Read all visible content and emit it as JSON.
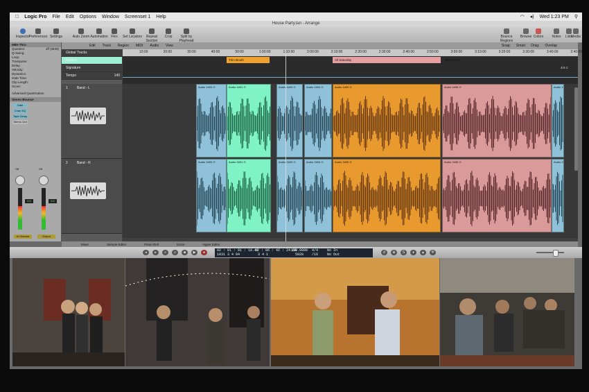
{
  "menubar": {
    "apple": "",
    "app": "Logic Pro",
    "items": [
      "File",
      "Edit",
      "Options",
      "Window",
      "Screenset 1",
      "Help"
    ],
    "clock": "Wed 1:23 PM"
  },
  "window": {
    "title": "House Party.lan - Arrange"
  },
  "toolbar": {
    "left": [
      "Inspector",
      "Preferences",
      "Settings",
      "Auto Zoom",
      "Automation",
      "Flex",
      "Set Locators",
      "Repeat Section",
      "Crop",
      "Split by Playhead"
    ],
    "right": [
      "Bounce Regions",
      "Browse",
      "Colors",
      "Notes",
      "Lists",
      "Media"
    ]
  },
  "inspector": {
    "title": "MIDI Thru",
    "rows": [
      {
        "k": "Quantize:",
        "v": "off (3840)"
      },
      {
        "k": "Q-Swing:",
        "v": ""
      },
      {
        "k": "Loop:",
        "v": ""
      },
      {
        "k": "Transpose:",
        "v": ""
      },
      {
        "k": "Delay:",
        "v": ""
      },
      {
        "k": "Velocity:",
        "v": ""
      },
      {
        "k": "Dynamics:",
        "v": ""
      },
      {
        "k": "Gate Time:",
        "v": ""
      },
      {
        "k": "Clip Length:",
        "v": ""
      },
      {
        "k": "Score:",
        "v": ""
      }
    ],
    "advanced": "Advanced Quantization",
    "sub": "Stereo Bounce",
    "btn1": "Gate",
    "btn2": "Chan EQ",
    "btn3": "Tape Delay",
    "stereo_out": "Stereo Out",
    "ch1_off": "Off",
    "ch2_off": "Off",
    "ch1_val": "0.0",
    "ch2_val": "0.0",
    "ch1_label": "Ac Bassist",
    "ch2_label": "Output"
  },
  "local": {
    "items": [
      "Edit",
      "Track",
      "Region",
      "MIDI",
      "Audio",
      "View"
    ],
    "snap_label": "Snap:",
    "snap": "Smart",
    "drag_label": "Drag:",
    "drag": "Overlap"
  },
  "tracks": {
    "global": "Global Tracks",
    "marker": "Marker",
    "signature": "Signature",
    "tempo": "Tempo",
    "tempo_vals": [
      "140",
      "100"
    ],
    "t1": "Band - L",
    "t2": "Band - R",
    "num1": "1",
    "num2": "2"
  },
  "ruler": [
    "10:00",
    "20:00",
    "30:00",
    "40:00",
    "50:00",
    "1:00:00",
    "1:10:00",
    "2:00:00",
    "2:10:00",
    "2:20:00",
    "2:30:00",
    "2:40:00",
    "2:50:00",
    "3:00:00",
    "3:10:00",
    "3:20:00",
    "3:30:00",
    "3:40:00",
    "2:40:00"
  ],
  "markers": [
    {
      "label": "Trim Booth",
      "color": "#9ff0d4"
    },
    {
      "label": "All Saturday",
      "color": "#f0a22e"
    },
    {
      "label": "Blue Crazy",
      "color": "#e7a0a2"
    }
  ],
  "signature_right": "4/4 C",
  "regions_top": [
    "Audio 1#00 ⊙",
    "Audio 1#01 ⊙",
    "Audio 1#03 ⊙",
    "Audio 1#04 ⊙",
    "Audio 1#05 ⊙",
    "Audio 1#06 ⊙",
    "Audio 1#07 ⊙"
  ],
  "regions_bot": [
    "Audio 2#00 ⊙",
    "Audio 2#01 ⊙",
    "Audio 2#03 ⊙",
    "Audio 2#04 ⊙",
    "Audio 2#05 ⊙",
    "Audio 2#06 ⊙",
    "Audio 2#07 ⊙"
  ],
  "bottom_tabs": [
    "Mixer",
    "Sample Editor",
    "Piano Roll",
    "Score",
    "Hyper Editor"
  ],
  "transport": {
    "smpte": "02 : 01 : 01 : 10.47",
    "bars": "1031  3  4  94",
    "time2": "02 : 06 : 42 : 24.68",
    "beats2": "3 4 1",
    "tempo": "120.0000",
    "tempo2": "5028",
    "sig": "4/4",
    "div": "/16",
    "in": "No In",
    "out": "No Out"
  },
  "colors": {
    "mint": "#7ff2c6",
    "orange": "#e89a2f",
    "rose": "#d99a99",
    "blue": "#8fc2d9"
  }
}
